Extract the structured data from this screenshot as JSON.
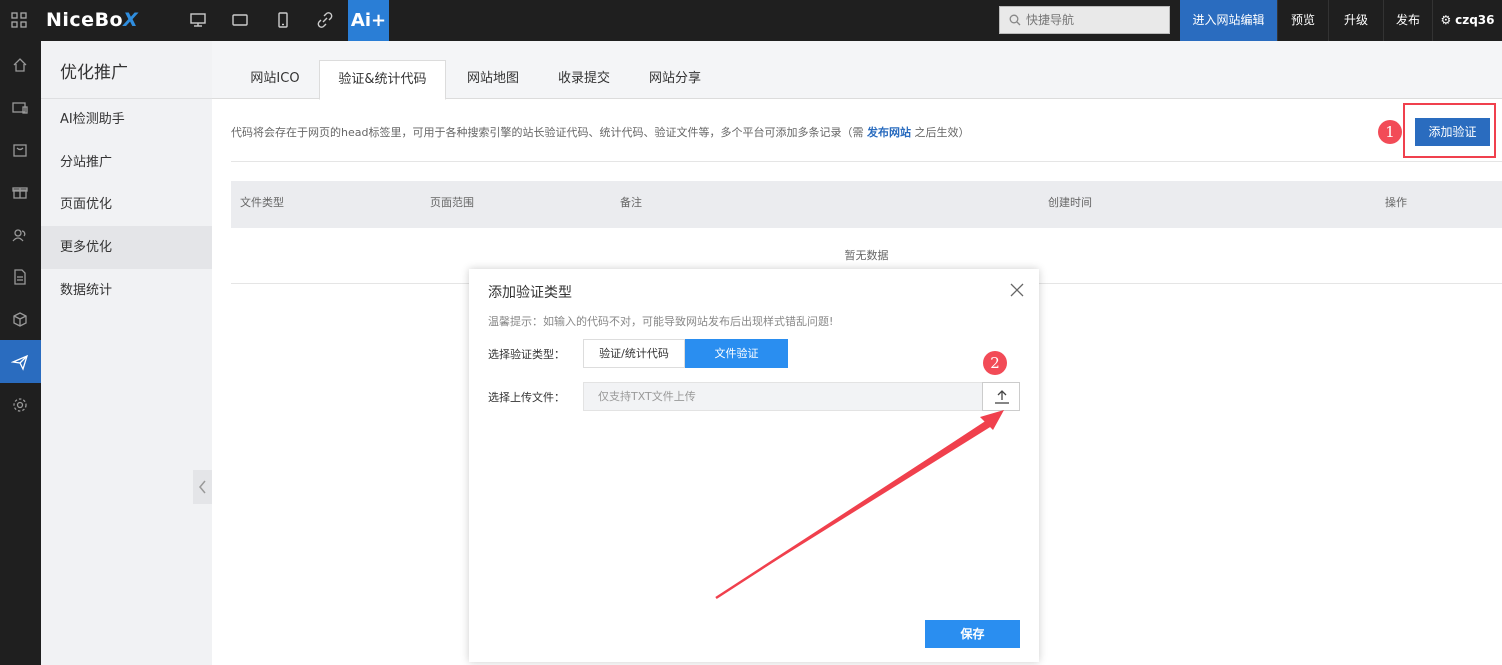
{
  "topbar": {
    "logo_main": "NiceBo",
    "logo_x": "X",
    "ai_label": "Ai+",
    "search_placeholder": "快捷导航",
    "edit_label": "进入网站编辑",
    "preview_label": "预览",
    "upgrade_label": "升级",
    "publish_label": "发布",
    "user_label": "czq36"
  },
  "sidebar": {
    "title": "优化推广",
    "items": [
      {
        "label": "AI检测助手"
      },
      {
        "label": "分站推广"
      },
      {
        "label": "页面优化"
      },
      {
        "label": "更多优化"
      },
      {
        "label": "数据统计"
      }
    ]
  },
  "tabs": [
    {
      "label": "网站ICO"
    },
    {
      "label": "验证&统计代码"
    },
    {
      "label": "网站地图"
    },
    {
      "label": "收录提交"
    },
    {
      "label": "网站分享"
    }
  ],
  "main": {
    "info_prefix": "代码将会存在于网页的head标签里，可用于各种搜索引擎的站长验证代码、统计代码、验证文件等，多个平台可添加多条记录（需 ",
    "info_link": "发布网站",
    "info_suffix": " 之后生效）",
    "add_button": "添加验证",
    "table_headers": [
      "文件类型",
      "页面范围",
      "备注",
      "创建时间",
      "操作"
    ],
    "empty_text": "暂无数据"
  },
  "modal": {
    "title": "添加验证类型",
    "tip": "温馨提示：如输入的代码不对，可能导致网站发布后出现样式错乱问题!",
    "type_label": "选择验证类型：",
    "type_options": [
      "验证/统计代码",
      "文件验证"
    ],
    "selected_type": "文件验证",
    "upload_label": "选择上传文件：",
    "upload_placeholder": "仅支持TXT文件上传",
    "save_button": "保存"
  },
  "annotations": {
    "badge1": "1",
    "badge2": "2",
    "highlight_color": "#f0404d"
  },
  "colors": {
    "accent": "#2a6cbf",
    "modal_accent": "#2a8ef0",
    "topbar_bg": "#1f1f1f"
  }
}
